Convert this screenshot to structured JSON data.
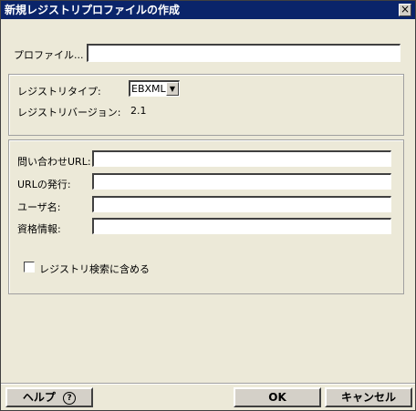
{
  "window": {
    "title": "新規レジストリプロファイルの作成",
    "close_label": "×"
  },
  "profile": {
    "label": "プロファイル...",
    "value": ""
  },
  "registry": {
    "type_label": "レジストリタイプ:",
    "type_value": "EBXML",
    "version_label": "レジストリバージョン:",
    "version_value": "2.1"
  },
  "connection": {
    "query_url_label": "問い合わせURL:",
    "query_url_value": "",
    "publish_url_label": "URLの発行:",
    "publish_url_value": "",
    "username_label": "ユーザ名:",
    "username_value": "",
    "credentials_label": "資格情報:",
    "credentials_value": "",
    "include_search_label": "レジストリ検索に含める"
  },
  "buttons": {
    "help": "ヘルプ",
    "help_icon": "?",
    "ok": "OK",
    "cancel": "キャンセル"
  }
}
